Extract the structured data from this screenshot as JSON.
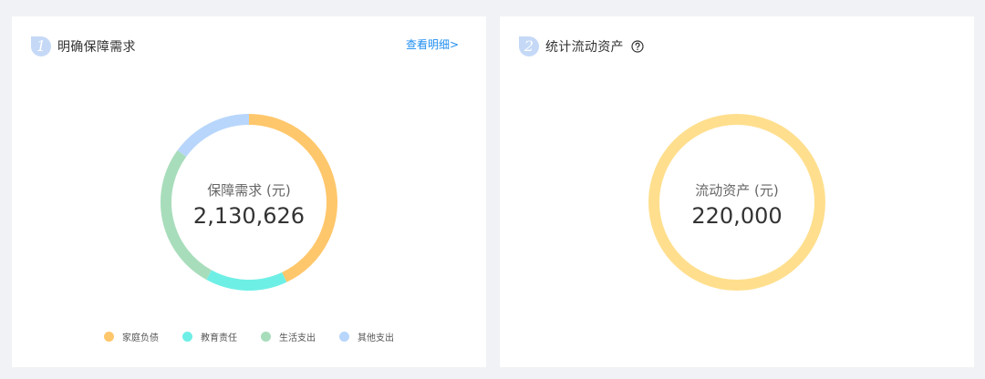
{
  "card1": {
    "step": "1",
    "title": "明确保障需求",
    "detail_link": "查看明细>",
    "center_label": "保障需求 (元)",
    "center_value": "2,130,626"
  },
  "card2": {
    "step": "2",
    "title": "统计流动资产",
    "center_label": "流动资产 (元)",
    "center_value": "220,000"
  },
  "colors": {
    "badge": "#c5d9f7",
    "link": "#1f8ef1"
  },
  "chart_data": [
    {
      "type": "pie",
      "categories": [
        "家庭负债",
        "教育责任",
        "生活支出",
        "其他支出"
      ],
      "values": [
        43,
        15,
        27,
        15
      ],
      "colors": [
        "#ffc76b",
        "#6eefe6",
        "#a8ddbb",
        "#b8d6fb"
      ],
      "legend": "bottom",
      "total": 2130626
    },
    {
      "type": "pie",
      "categories": [
        ""
      ],
      "values": [
        220000
      ],
      "colors": [
        "#ffdf8e"
      ],
      "total": 220000
    }
  ]
}
